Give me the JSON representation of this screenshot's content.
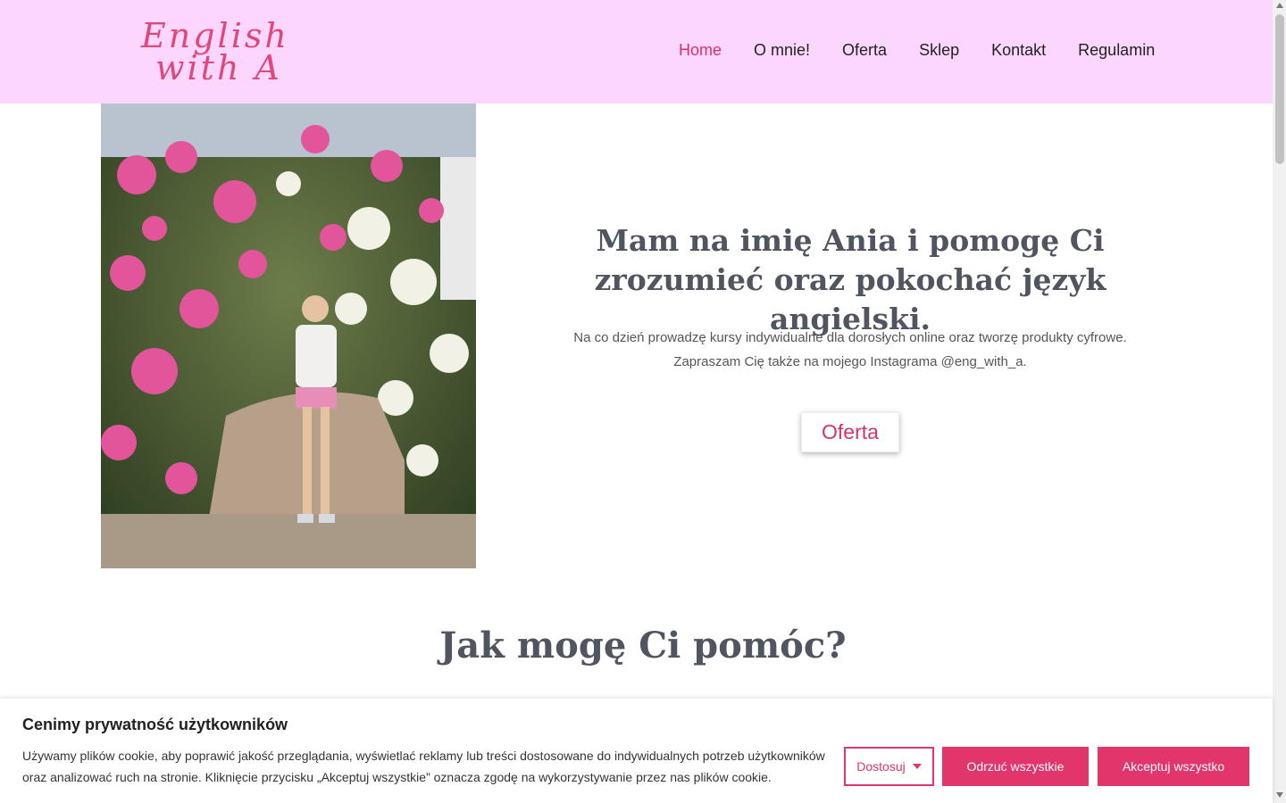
{
  "header": {
    "logo_line1": "English",
    "logo_line2": "with A",
    "nav": [
      {
        "label": "Home",
        "active": true
      },
      {
        "label": "O mnie!"
      },
      {
        "label": "Oferta"
      },
      {
        "label": "Sklep"
      },
      {
        "label": "Kontakt"
      },
      {
        "label": "Regulamin"
      }
    ]
  },
  "hero": {
    "title": "Mam na imię Ania i pomogę Ci zrozumieć oraz pokochać język angielski.",
    "text_line1": "Na co dzień prowadzę kursy indywidualne dla dorosłych online oraz tworzę produkty cyfrowe.",
    "text_line2": "Zapraszam Cię także na mojego Instagrama @eng_with_a.",
    "button_label": "Oferta"
  },
  "section": {
    "title": "Jak mogę Ci pomóc?"
  },
  "cookie": {
    "title": "Cenimy prywatność użytkowników",
    "text": "Używamy plików cookie, aby poprawić jakość przeglądania, wyświetlać reklamy lub treści dostosowane do indywidualnych potrzeb użytkowników oraz analizować ruch na stronie. Kliknięcie przycisku „Akceptuj wszystkie” oznacza zgodę na wykorzystywanie przez nas plików cookie.",
    "customize_label": "Dostosuj",
    "reject_label": "Odrzuć wszystkie",
    "accept_label": "Akceptuj wszystko"
  },
  "colors": {
    "header_bg": "#fdd6fd",
    "accent": "#e2356c",
    "heading": "#505560"
  }
}
